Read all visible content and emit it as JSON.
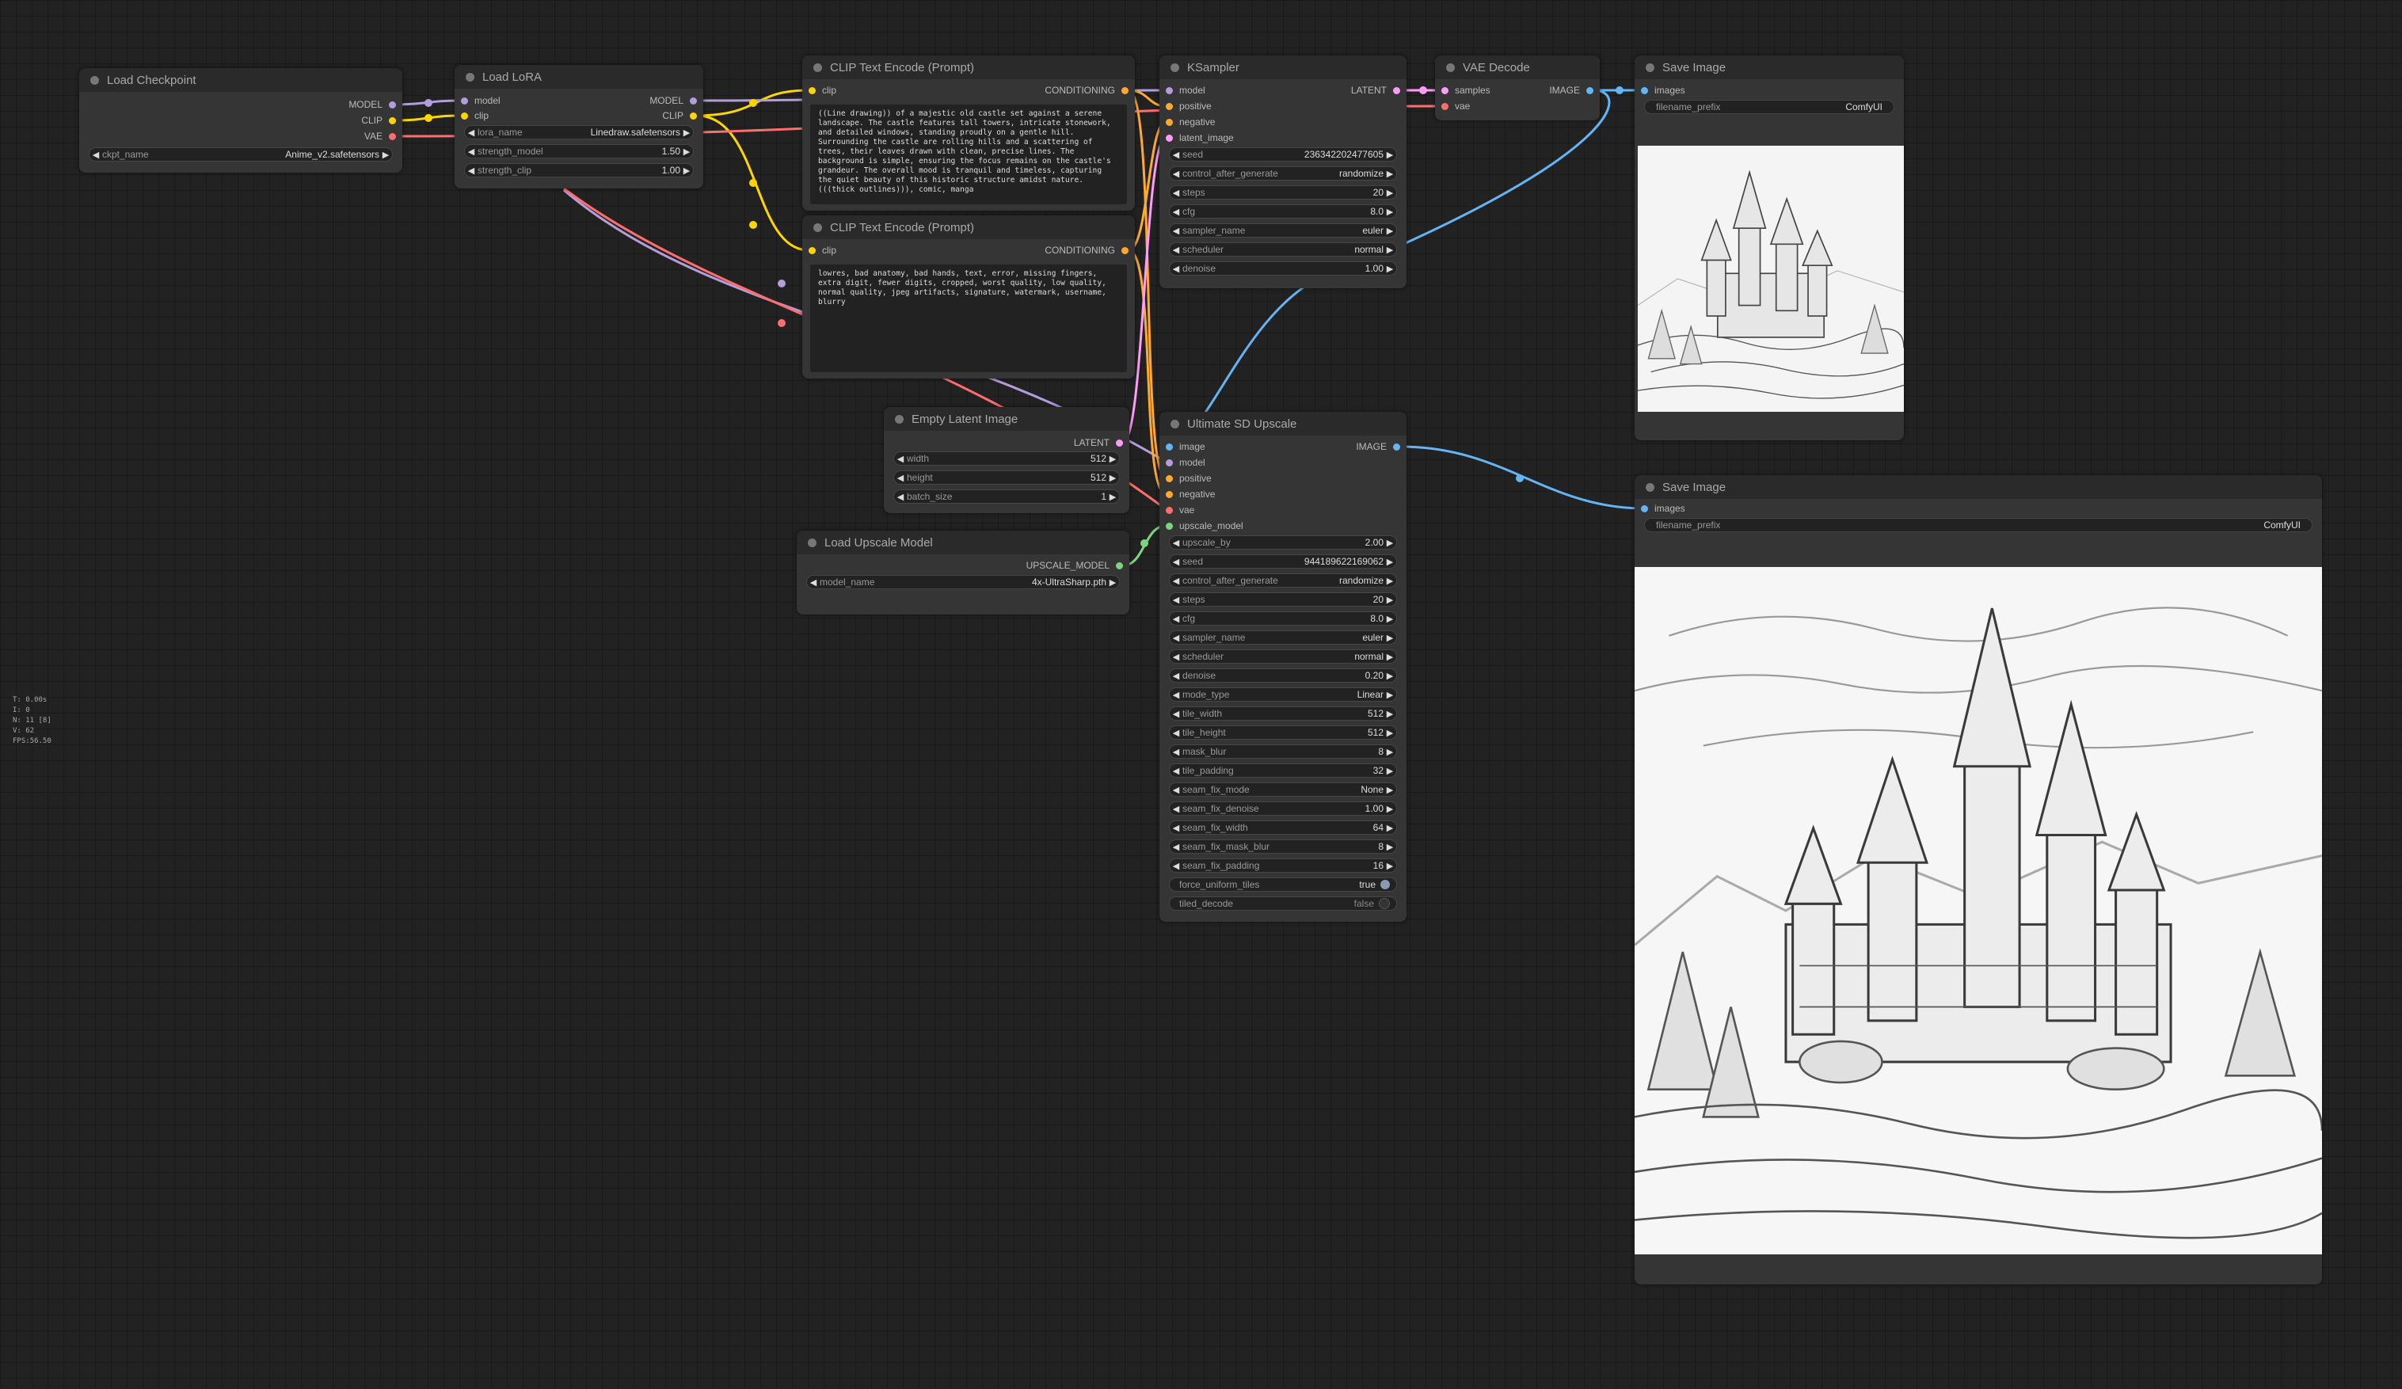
{
  "app": "ComfyUI",
  "colors": {
    "model": "#b39ddb",
    "clip": "#ffd500",
    "vae": "#ff6e6e",
    "conditioning": "#ffa931",
    "latent": "#ff9cf9",
    "image": "#64b5f6",
    "upscale_model": "#7ed37e",
    "background": "#222222",
    "node": "#353535"
  },
  "stats": {
    "t": "T: 0.00s",
    "i": "I: 0",
    "n": "N: 11 [8]",
    "v": "V: 62",
    "fps": "FPS:56.50"
  },
  "load_checkpoint": {
    "title": "Load Checkpoint",
    "outputs": [
      "MODEL",
      "CLIP",
      "VAE"
    ],
    "ckpt_name_label": "ckpt_name",
    "ckpt_name_value": "Anime_v2.safetensors"
  },
  "load_lora": {
    "title": "Load LoRA",
    "inputs": [
      "model",
      "clip"
    ],
    "outputs": [
      "MODEL",
      "CLIP"
    ],
    "widgets": [
      {
        "label": "lora_name",
        "value": "Linedraw.safetensors"
      },
      {
        "label": "strength_model",
        "value": "1.50"
      },
      {
        "label": "strength_clip",
        "value": "1.00"
      }
    ]
  },
  "clip_positive": {
    "title": "CLIP Text Encode (Prompt)",
    "input": "clip",
    "output": "CONDITIONING",
    "text": "((Line drawing)) of a majestic old castle set against a serene landscape. The castle features tall towers, intricate stonework, and detailed windows, standing proudly on a gentle hill. Surrounding the castle are rolling hills and a scattering of trees, their leaves drawn with clean, precise lines. The background is simple, ensuring the focus remains on the castle's grandeur. The overall mood is tranquil and timeless, capturing the quiet beauty of this historic structure amidst nature. (((thick outlines))), comic, manga"
  },
  "clip_negative": {
    "title": "CLIP Text Encode (Prompt)",
    "input": "clip",
    "output": "CONDITIONING",
    "text": "lowres, bad anatomy, bad hands, text, error, missing fingers, extra digit, fewer digits, cropped, worst quality, low quality, normal quality, jpeg artifacts, signature, watermark, username, blurry"
  },
  "ksampler": {
    "title": "KSampler",
    "inputs": [
      "model",
      "positive",
      "negative",
      "latent_image"
    ],
    "output": "LATENT",
    "widgets": [
      {
        "label": "seed",
        "value": "236342202477605"
      },
      {
        "label": "control_after_generate",
        "value": "randomize"
      },
      {
        "label": "steps",
        "value": "20"
      },
      {
        "label": "cfg",
        "value": "8.0"
      },
      {
        "label": "sampler_name",
        "value": "euler"
      },
      {
        "label": "scheduler",
        "value": "normal"
      },
      {
        "label": "denoise",
        "value": "1.00"
      }
    ]
  },
  "vae_decode": {
    "title": "VAE Decode",
    "inputs": [
      "samples",
      "vae"
    ],
    "output": "IMAGE"
  },
  "save_image_1": {
    "title": "Save Image",
    "input": "images",
    "prefix_label": "filename_prefix",
    "prefix_value": "ComfyUI"
  },
  "save_image_2": {
    "title": "Save Image",
    "input": "images",
    "prefix_label": "filename_prefix",
    "prefix_value": "ComfyUI"
  },
  "empty_latent": {
    "title": "Empty Latent Image",
    "output": "LATENT",
    "widgets": [
      {
        "label": "width",
        "value": "512"
      },
      {
        "label": "height",
        "value": "512"
      },
      {
        "label": "batch_size",
        "value": "1"
      }
    ]
  },
  "load_upscale": {
    "title": "Load Upscale Model",
    "output": "UPSCALE_MODEL",
    "model_name_label": "model_name",
    "model_name_value": "4x-UltraSharp.pth"
  },
  "ultimate_upscale": {
    "title": "Ultimate SD Upscale",
    "inputs": [
      "image",
      "model",
      "positive",
      "negative",
      "vae",
      "upscale_model"
    ],
    "output": "IMAGE",
    "widgets": [
      {
        "label": "upscale_by",
        "value": "2.00"
      },
      {
        "label": "seed",
        "value": "944189622169062"
      },
      {
        "label": "control_after_generate",
        "value": "randomize"
      },
      {
        "label": "steps",
        "value": "20"
      },
      {
        "label": "cfg",
        "value": "8.0"
      },
      {
        "label": "sampler_name",
        "value": "euler"
      },
      {
        "label": "scheduler",
        "value": "normal"
      },
      {
        "label": "denoise",
        "value": "0.20"
      },
      {
        "label": "mode_type",
        "value": "Linear"
      },
      {
        "label": "tile_width",
        "value": "512"
      },
      {
        "label": "tile_height",
        "value": "512"
      },
      {
        "label": "mask_blur",
        "value": "8"
      },
      {
        "label": "tile_padding",
        "value": "32"
      },
      {
        "label": "seam_fix_mode",
        "value": "None"
      },
      {
        "label": "seam_fix_denoise",
        "value": "1.00"
      },
      {
        "label": "seam_fix_width",
        "value": "64"
      },
      {
        "label": "seam_fix_mask_blur",
        "value": "8"
      },
      {
        "label": "seam_fix_padding",
        "value": "16"
      }
    ],
    "toggles": [
      {
        "label": "force_uniform_tiles",
        "value": "true"
      },
      {
        "label": "tiled_decode",
        "value": "false"
      }
    ]
  }
}
